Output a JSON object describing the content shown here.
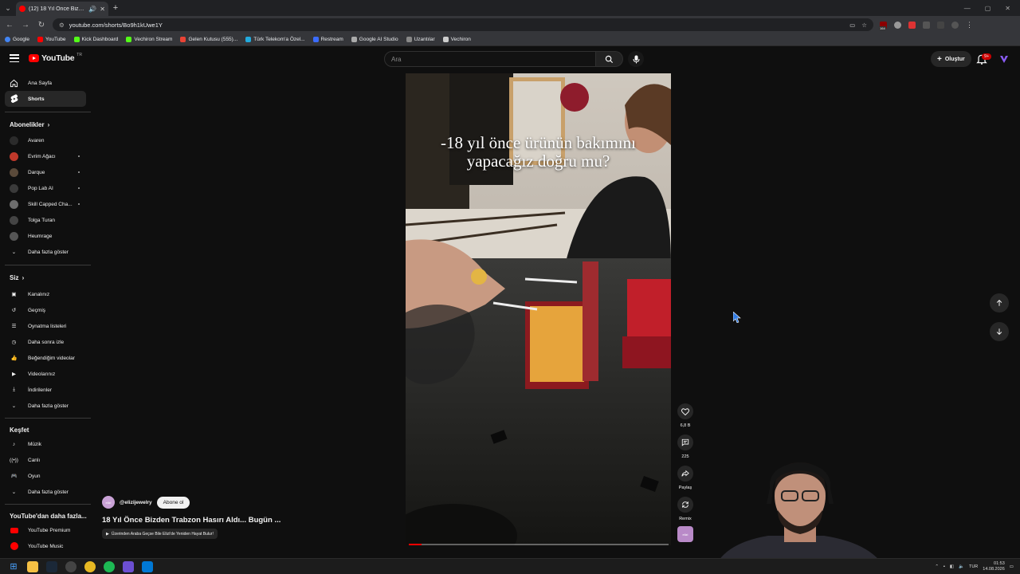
{
  "browser": {
    "tab_title": "(12) 18 Yıl Önce Bizden Trabzon Hasırı Aldı",
    "url": "youtube.com/shorts/Bo9h1kUwe1Y",
    "bookmarks": [
      "Google",
      "YouTube",
      "Kick Dashboard",
      "Vechiron Stream",
      "Gelen Kutusu (555)...",
      "Türk Telekom'a Özel...",
      "Restream",
      "Google AI Studio",
      "Uzantılar",
      "Vechiron"
    ],
    "extension_badge": "164"
  },
  "header": {
    "logo_text": "YouTube",
    "country_code": "TR",
    "search_placeholder": "Ara",
    "create_label": "Oluştur",
    "notif_badge": "9+"
  },
  "sidebar": {
    "main": [
      {
        "label": "Ana Sayfa",
        "icon": "home-icon"
      },
      {
        "label": "Shorts",
        "icon": "shorts-icon",
        "active": true
      }
    ],
    "subs_heading": "Abonelikler",
    "subscriptions": [
      {
        "label": "Avaren",
        "color": "#2b2b2b"
      },
      {
        "label": "Evrim Ağacı",
        "color": "#c0392b"
      },
      {
        "label": "Darque",
        "color": "#5a4a3a"
      },
      {
        "label": "Pop Lab AI",
        "color": "#3a3a3a"
      },
      {
        "label": "Skill Capped Cha...",
        "color": "#6d6d6d"
      },
      {
        "label": "Tolga Turan",
        "color": "#444"
      },
      {
        "label": "Heumrage",
        "color": "#555"
      }
    ],
    "subs_more": "Daha fazla göster",
    "you_heading": "Siz",
    "you_items": [
      "Kanalınız",
      "Geçmiş",
      "Oynatma listeleri",
      "Daha sonra izle",
      "Beğendiğim videolar",
      "Videolarınız",
      "İndirilenler"
    ],
    "you_more": "Daha fazla göster",
    "explore_heading": "Keşfet",
    "explore_items": [
      "Müzik",
      "Canlı",
      "Oyun"
    ],
    "explore_more": "Daha fazla göster",
    "more_heading": "YouTube'dan daha fazla...",
    "more_items": [
      "YouTube Premium",
      "YouTube Music"
    ]
  },
  "video": {
    "caption": "-18 yıl önce ürünün bakımını yapacağız doğru mu?",
    "progress": 0.05,
    "channel_handle": "@elizijewelry",
    "channel_avatar_text": "elizi",
    "subscribe_label": "Abone ol",
    "title": "18 Yıl Önce Bizden Trabzon Hasırı Aldı... Bugün ...",
    "related_link": "Üzerinden Araba Geçse Bile Elizi'de Yeniden Hayat Bulur!"
  },
  "actions": {
    "likes": "6,8 B",
    "comments": "225",
    "share": "Paylaş",
    "remix": "Remix",
    "sound_label": "elizi"
  },
  "taskbar": {
    "lang": "TUR",
    "time": "01:53",
    "date": "14.08.2026"
  }
}
